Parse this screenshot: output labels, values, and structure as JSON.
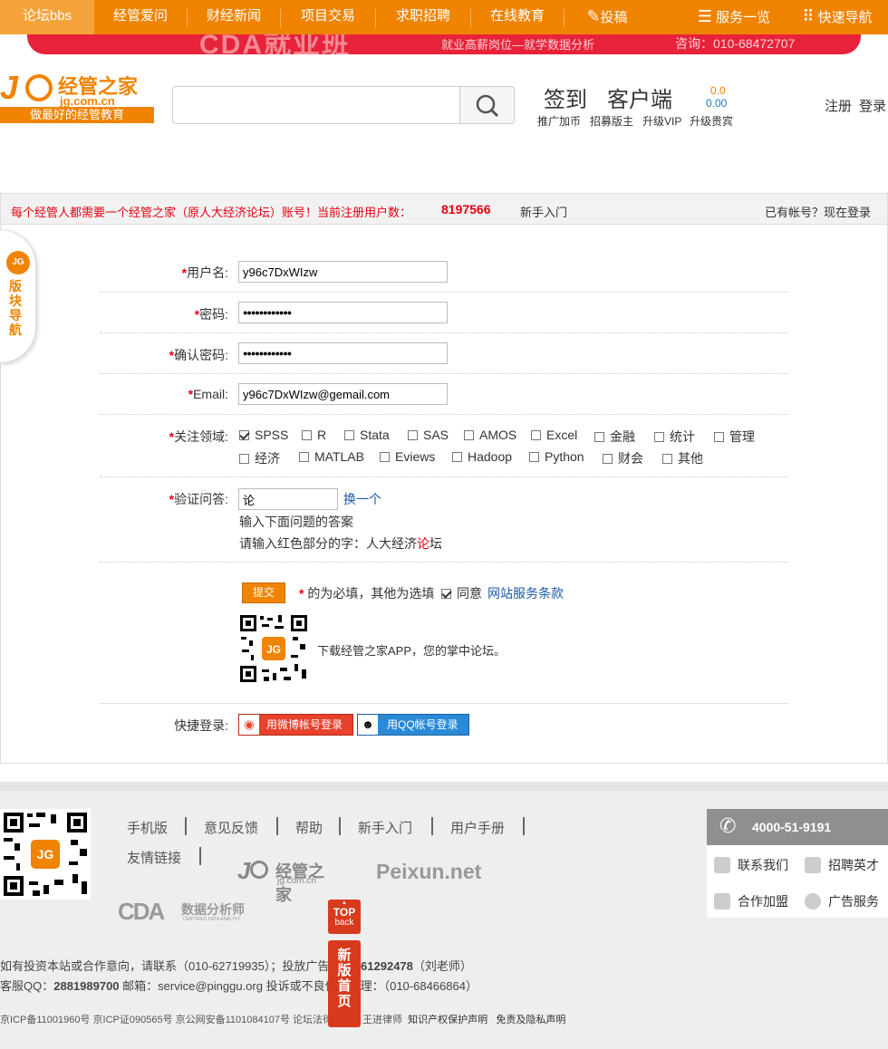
{
  "nav": {
    "items": [
      "论坛bbs",
      "经管爱问",
      "财经新闻",
      "项目交易",
      "求职招聘",
      "在线教育",
      "投稿"
    ],
    "service": "服务一览",
    "quicknav": "快速导航"
  },
  "banner": {
    "big": "CDA就业班",
    "sub": "就业高薪岗位—就学数据分析",
    "phone": "咨询：010-68472707"
  },
  "logo": {
    "cn": "经管之家",
    "domain": "jg.com.cn",
    "slogan": "做最好的经管教育"
  },
  "header": {
    "checkin": "签到",
    "client": "客户端",
    "coins": "0.0",
    "balance": "0.00",
    "links": [
      "推广加币",
      "招募版主",
      "升级VIP",
      "升级贵宾"
    ],
    "register": "注册",
    "login": "登录"
  },
  "regbar": {
    "message": "每个经管人都需要一个经管之家（原人大经济论坛）账号！当前注册用户数：",
    "count": "8197566",
    "newbie": "新手入门",
    "have_account": "已有帐号？现在登录"
  },
  "sidetab": {
    "label": "版块导航"
  },
  "form": {
    "username_label": "用户名:",
    "username": "y96c7DxWIzw",
    "password_label": "密码:",
    "password": "●●●●●●●●●●●●",
    "confirm_label": "确认密码:",
    "confirm": "●●●●●●●●●●●●",
    "email_label": "Email:",
    "email": "y96c7DxWIzw@gemail.com",
    "fields_label": "关注领域:",
    "fields_row1": [
      "SPSS",
      "R",
      "Stata",
      "SAS",
      "AMOS",
      "Excel",
      "金融",
      "统计",
      "管理"
    ],
    "fields_row2": [
      "经济",
      "MATLAB",
      "Eviews",
      "Hadoop",
      "Python",
      "财会",
      "其他"
    ],
    "captcha_label": "验证问答:",
    "captcha_value": "论",
    "captcha_change": "换一个",
    "captcha_hint": "输入下面问题的答案",
    "captcha_q_prefix": "请输入红色部分的字：人大经济",
    "captcha_q_red": "论",
    "captcha_q_suffix": "坛",
    "submit": "提交",
    "required_note": "的为必填，其他为选填",
    "agree": "同意",
    "terms": "网站服务条款",
    "app_text": "下载经管之家APP，您的掌中论坛。",
    "quick_login_label": "快捷登录:",
    "weibo_login": "用微博帐号登录",
    "qq_login": "用QQ帐号登录"
  },
  "footer": {
    "links": [
      "手机版",
      "意见反馈",
      "帮助",
      "新手入门",
      "用户手册"
    ],
    "friends": "友情链接",
    "partner_jg": "经管之家",
    "partner_jg_domain": "jg.com.cn",
    "partner_peixun": "Peixun.net",
    "partner_cda": "数据分析师",
    "partner_cda_sub": "CERTIFIED DATA ANALYST",
    "line1_a": "如有投资本站或合作意向，请联系（010-62719935）；投放广告：",
    "line1_phone": "13661292478",
    "line1_b": "（刘老师）",
    "line2_a": "客服QQ：",
    "line2_qq": "2881989700",
    "line2_b": " 邮箱：service@pinggu.org 投诉或不良信息处理：（010-68466864）",
    "icp": "京ICP备11001960号 京ICP证090565号 京公网安备1101084107号 论坛法律顾问：王进律师",
    "ip": "知识产权保护声明",
    "privacy": "免责及隐私声明",
    "hotline": "4000-51-9191",
    "contact": "联系我们",
    "jobs": "招聘英才",
    "coop": "合作加盟",
    "ads": "广告服务",
    "top1": "TOP",
    "top2": "back",
    "newhome": "新版首页"
  },
  "colors": {
    "brand": "#f08300",
    "accent": "#e60012",
    "link": "#1a5aa8"
  }
}
